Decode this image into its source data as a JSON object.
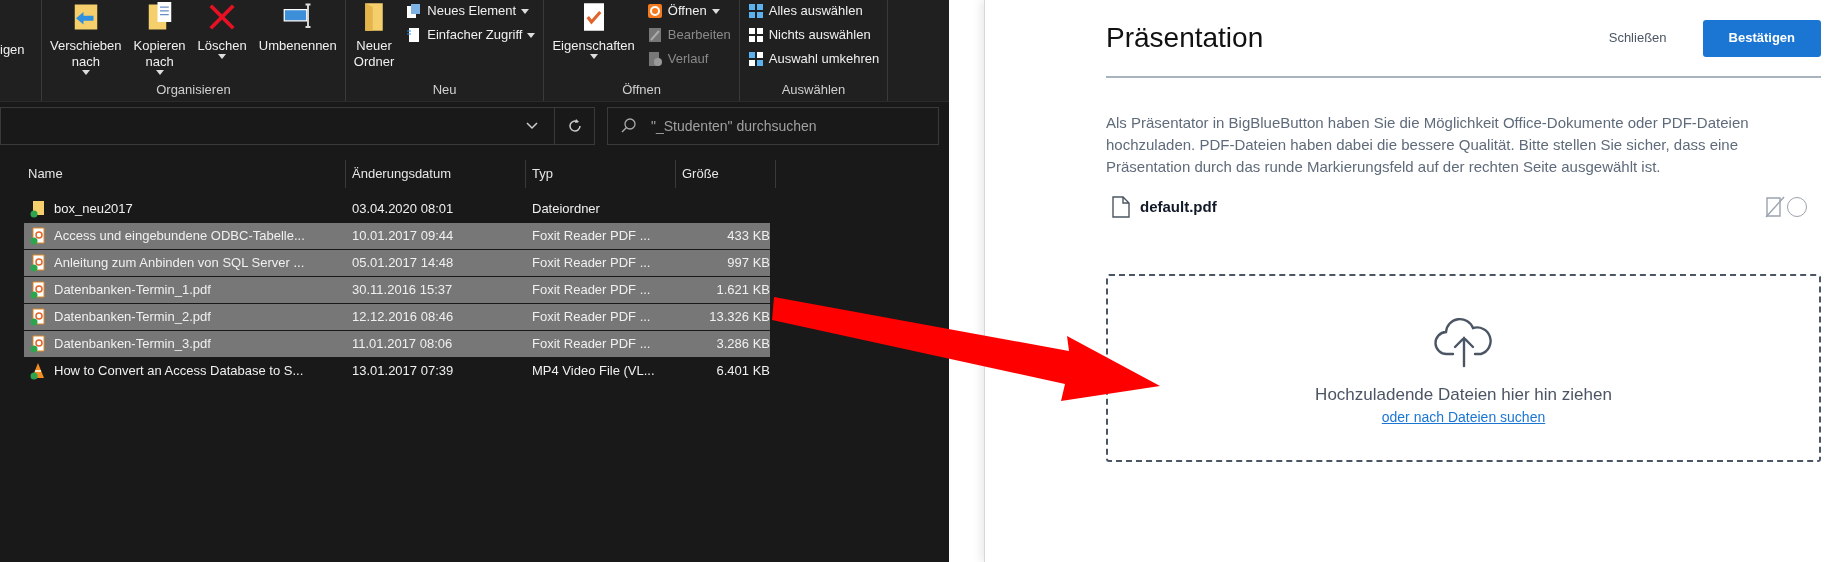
{
  "explorer": {
    "ribbon": {
      "cut_label": "igen",
      "groups": [
        {
          "label": "Organisieren",
          "items": [
            {
              "kind": "large",
              "label": "Verschieben\nnach",
              "dropdown": true
            },
            {
              "kind": "large",
              "label": "Kopieren\nnach",
              "dropdown": true
            },
            {
              "kind": "large",
              "label": "Löschen",
              "dropdown": true
            },
            {
              "kind": "large",
              "label": "Umbenennen",
              "dropdown": false
            }
          ]
        },
        {
          "label": "Neu",
          "items": [
            {
              "kind": "large",
              "label": "Neuer\nOrdner",
              "dropdown": false
            },
            {
              "kind": "stack",
              "entries": [
                {
                  "label": "Neues Element",
                  "dropdown": true,
                  "disabled": false
                },
                {
                  "label": "Einfacher Zugriff",
                  "dropdown": true,
                  "disabled": false
                }
              ]
            }
          ]
        },
        {
          "label": "Öffnen",
          "items": [
            {
              "kind": "large",
              "label": "Eigenschaften",
              "dropdown": true
            },
            {
              "kind": "stack",
              "entries": [
                {
                  "label": "Öffnen",
                  "dropdown": true,
                  "disabled": false
                },
                {
                  "label": "Bearbeiten",
                  "dropdown": false,
                  "disabled": true
                },
                {
                  "label": "Verlauf",
                  "dropdown": false,
                  "disabled": true
                }
              ]
            }
          ]
        },
        {
          "label": "Auswählen",
          "items": [
            {
              "kind": "stack",
              "entries": [
                {
                  "label": "Alles auswählen",
                  "dropdown": false,
                  "disabled": false
                },
                {
                  "label": "Nichts auswählen",
                  "dropdown": false,
                  "disabled": false
                },
                {
                  "label": "Auswahl umkehren",
                  "dropdown": false,
                  "disabled": false
                }
              ]
            }
          ]
        }
      ]
    },
    "search": {
      "placeholder": "\"_Studenten\" durchsuchen"
    },
    "columns": [
      "Name",
      "Änderungsdatum",
      "Typ",
      "Größe"
    ],
    "files": [
      {
        "kind": "folder",
        "name": "box_neu2017",
        "date": "03.04.2020 08:01",
        "type": "Dateiordner",
        "selected": false
      },
      {
        "kind": "pdf",
        "name": "Access und eingebundene ODBC-Tabelle...",
        "date": "10.01.2017 09:44",
        "type": "Foxit Reader PDF ...",
        "size": "433 KB",
        "selected": true
      },
      {
        "kind": "pdf",
        "name": "Anleitung zum Anbinden von SQL Server ...",
        "date": "05.01.2017 14:48",
        "type": "Foxit Reader PDF ...",
        "size": "997 KB",
        "selected": true
      },
      {
        "kind": "pdf",
        "name": "Datenbanken-Termin_1.pdf",
        "date": "30.11.2016 15:37",
        "type": "Foxit Reader PDF ...",
        "size": "1.621 KB",
        "selected": true
      },
      {
        "kind": "pdf",
        "name": "Datenbanken-Termin_2.pdf",
        "date": "12.12.2016 08:46",
        "type": "Foxit Reader PDF ...",
        "size": "13.326 KB",
        "selected": true
      },
      {
        "kind": "pdf",
        "name": "Datenbanken-Termin_3.pdf",
        "date": "11.01.2017 08:06",
        "type": "Foxit Reader PDF ...",
        "size": "3.286 KB",
        "selected": true
      },
      {
        "kind": "video",
        "name": "How to Convert an Access Database to S...",
        "date": "13.01.2017 07:39",
        "type": "MP4 Video File (VL...",
        "size": "6.401 KB",
        "selected": false
      }
    ]
  },
  "dialog": {
    "title": "Präsentation",
    "close_label": "Schließen",
    "confirm_label": "Bestätigen",
    "description": "Als Präsentator in BigBlueButton haben Sie die Möglichkeit Office-Dokumente oder PDF-Dateien hochzuladen. PDF-Dateien haben dabei die bessere Qualität. Bitte stellen Sie sicher, dass eine Präsentation durch das runde Markierungsfeld auf der rechten Seite ausgewählt ist.",
    "files": [
      {
        "name": "default.pdf",
        "selected": false
      }
    ],
    "dropzone": {
      "text": "Hochzuladende Dateien hier hin ziehen",
      "link": "oder nach Dateien suchen"
    }
  }
}
